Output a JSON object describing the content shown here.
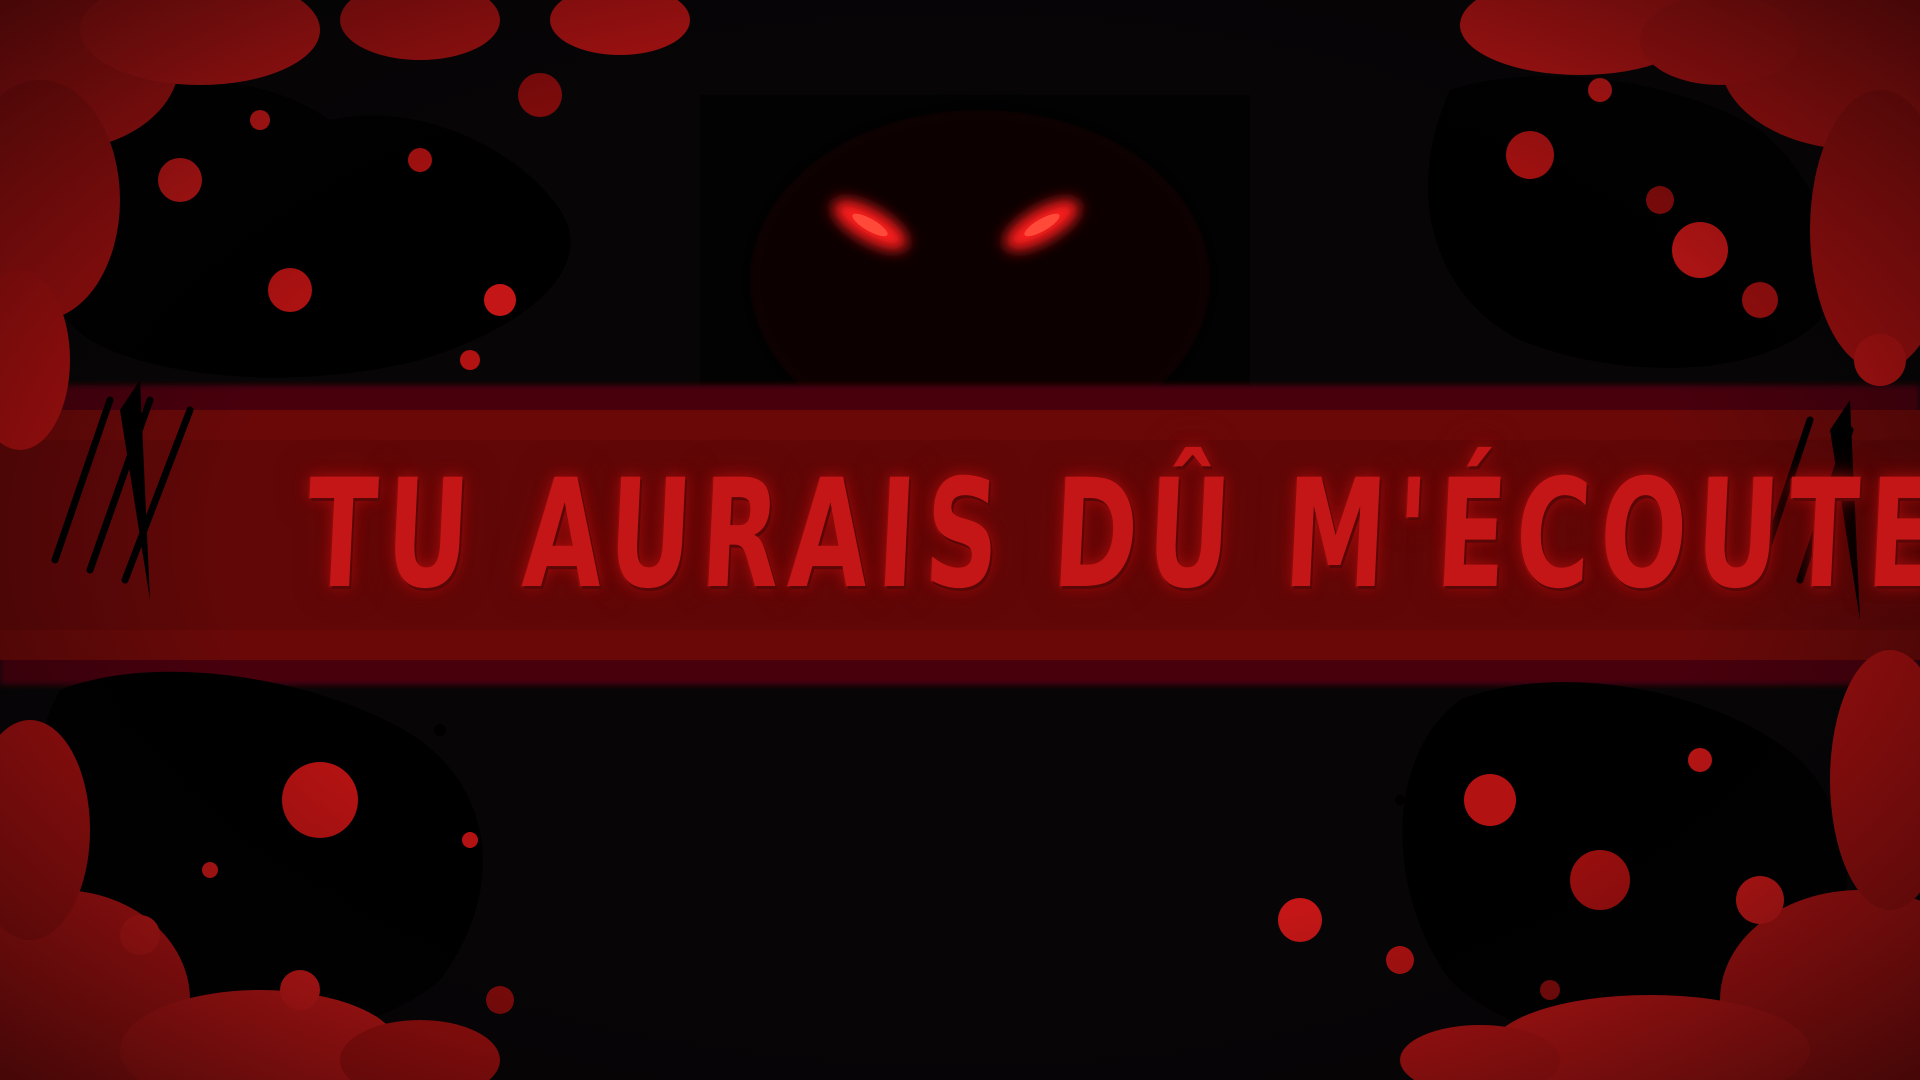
{
  "title": {
    "text": "TU AURAIS DÛ M'ÉCOUTER"
  },
  "colors": {
    "background": "#070506",
    "blood_bright": "#d01818",
    "blood_dark": "#8a0a0a",
    "banner": "#5a0606",
    "title_text": "#c41616",
    "eye_glow": "#ff1a1a"
  },
  "scene": {
    "creature": "glowing-red-eyes-shadow-creature",
    "decoration": "blood-splatter-frame"
  }
}
